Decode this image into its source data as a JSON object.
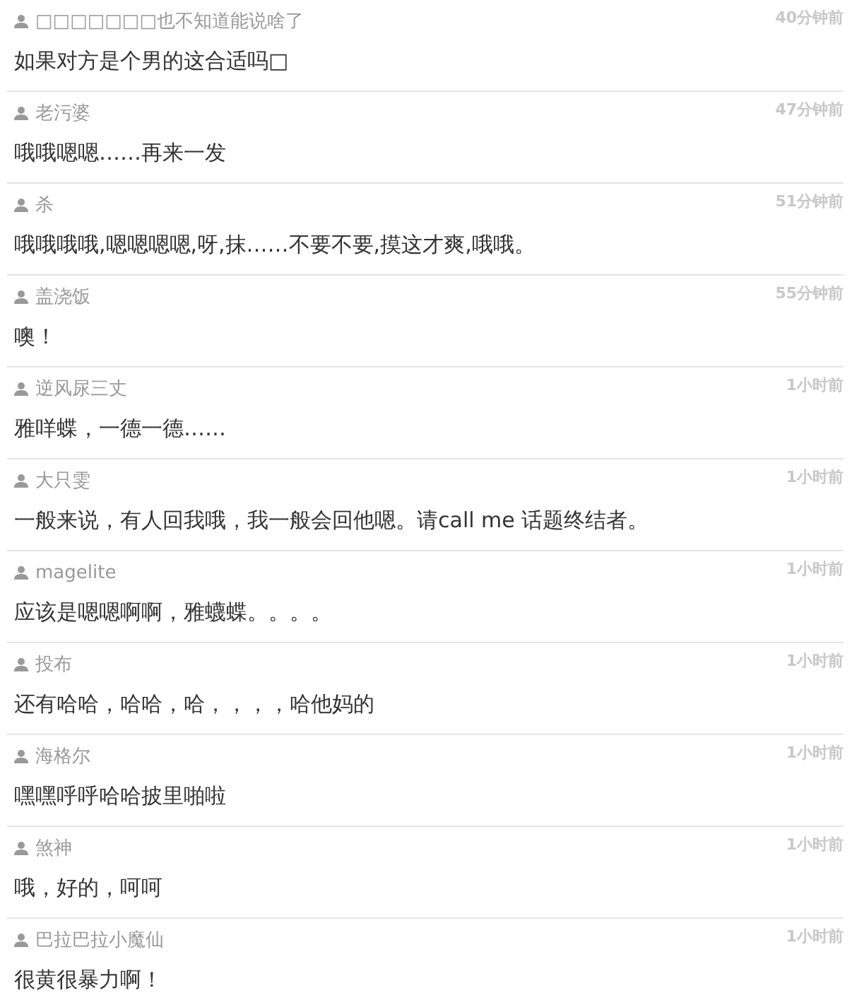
{
  "comments": [
    {
      "author": "□□□□□□□也不知道能说啥了",
      "time": "40分钟前",
      "text": "如果对方是个男的这合适吗□"
    },
    {
      "author": "老污婆",
      "time": "47分钟前",
      "text": "哦哦嗯嗯……再来一发"
    },
    {
      "author": "杀",
      "time": "51分钟前",
      "text": "哦哦哦哦,嗯嗯嗯嗯,呀,抹……不要不要,摸这才爽,哦哦。"
    },
    {
      "author": "盖浇饭",
      "time": "55分钟前",
      "text": "噢！"
    },
    {
      "author": "逆风尿三丈",
      "time": "1小时前",
      "text": "雅咩蝶，一德一德……"
    },
    {
      "author": "大只雯",
      "time": "1小时前",
      "text": "一般来说，有人回我哦，我一般会回他嗯。请call me 话题终结者。"
    },
    {
      "author": "magelite",
      "time": "1小时前",
      "text": "应该是嗯嗯啊啊，雅蠛蝶。。。。"
    },
    {
      "author": "投布",
      "time": "1小时前",
      "text": "还有哈哈，哈哈，哈，，，，哈他妈的"
    },
    {
      "author": "海格尔",
      "time": "1小时前",
      "text": "嘿嘿呼呼哈哈披里啪啦"
    },
    {
      "author": "煞神",
      "time": "1小时前",
      "text": "哦，好的，呵呵"
    },
    {
      "author": "巴拉巴拉小魔仙",
      "time": "1小时前",
      "text": "很黄很暴力啊！"
    }
  ]
}
